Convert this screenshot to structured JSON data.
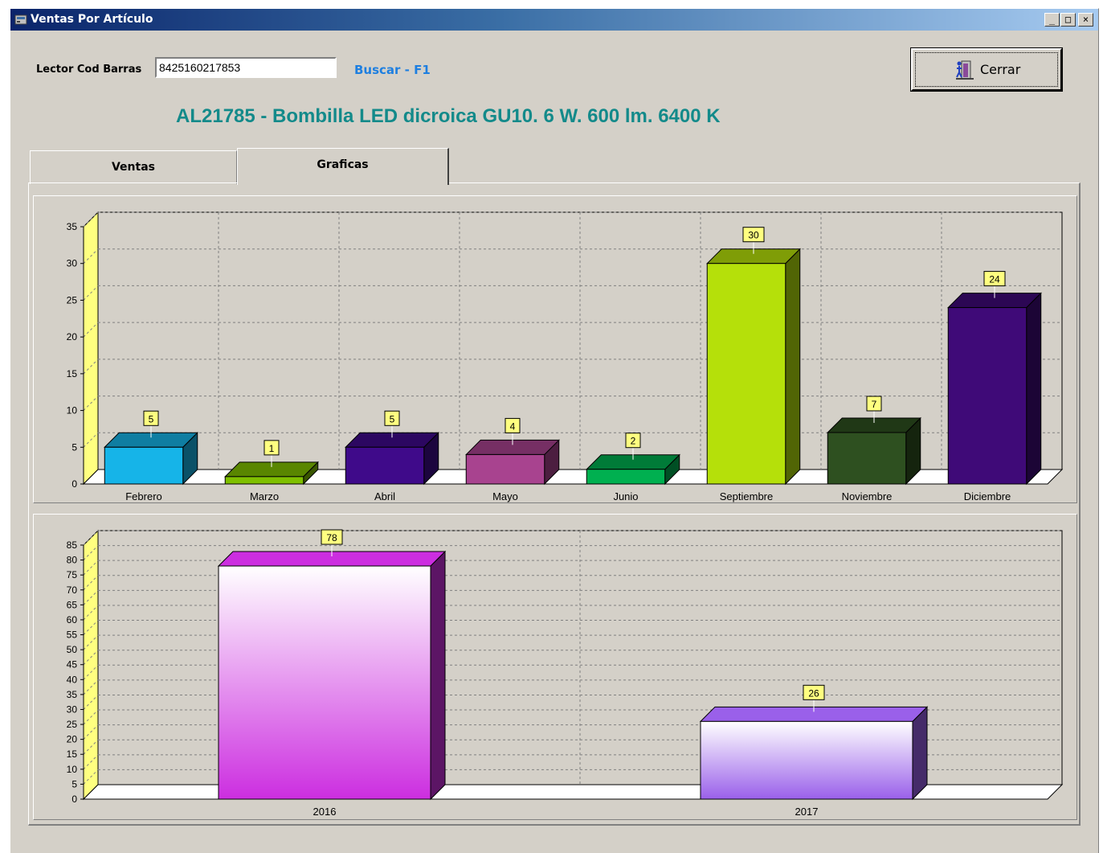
{
  "window": {
    "title": "Ventas Por Artículo",
    "controls": {
      "minimize": "_",
      "maximize": "□",
      "close": "×"
    }
  },
  "form": {
    "barcode_label": "Lector Cod Barras",
    "barcode_value": "8425160217853",
    "search_link": "Buscar - F1",
    "close_button": "Cerrar",
    "product_title": "AL21785 - Bombilla LED dicroica GU10. 6 W. 600 lm. 6400 K"
  },
  "tabs": [
    {
      "label": "Ventas",
      "active": false
    },
    {
      "label": "Graficas",
      "active": true
    }
  ],
  "colors": {
    "window_bg": "#d4d0c8",
    "title_accent": "#138a8a",
    "link": "#1e7fe0",
    "label_box": "#ffff80",
    "wall_left": "#ffff80"
  },
  "chart_data": [
    {
      "type": "bar",
      "categories": [
        "Febrero",
        "Marzo",
        "Abril",
        "Mayo",
        "Junio",
        "Septiembre",
        "Noviembre",
        "Diciembre"
      ],
      "values": [
        5,
        1,
        5,
        4,
        2,
        30,
        7,
        24
      ],
      "colors": [
        "#16b4e8",
        "#7fc000",
        "#3f0a8a",
        "#a8438f",
        "#00b050",
        "#b5e00a",
        "#2e5020",
        "#3f0a78"
      ],
      "yticks": [
        0,
        5,
        10,
        15,
        20,
        25,
        30,
        35
      ],
      "ylim": [
        0,
        35
      ],
      "grid": true,
      "data_labels": true
    },
    {
      "type": "bar",
      "categories": [
        "2016",
        "2017"
      ],
      "values": [
        78,
        26
      ],
      "colors": [
        "#cc2ee0",
        "#9a60ea"
      ],
      "yticks": [
        0,
        5,
        10,
        15,
        20,
        25,
        30,
        35,
        40,
        45,
        50,
        55,
        60,
        65,
        70,
        75,
        80,
        85
      ],
      "ylim": [
        0,
        85
      ],
      "grid": true,
      "data_labels": true
    }
  ]
}
